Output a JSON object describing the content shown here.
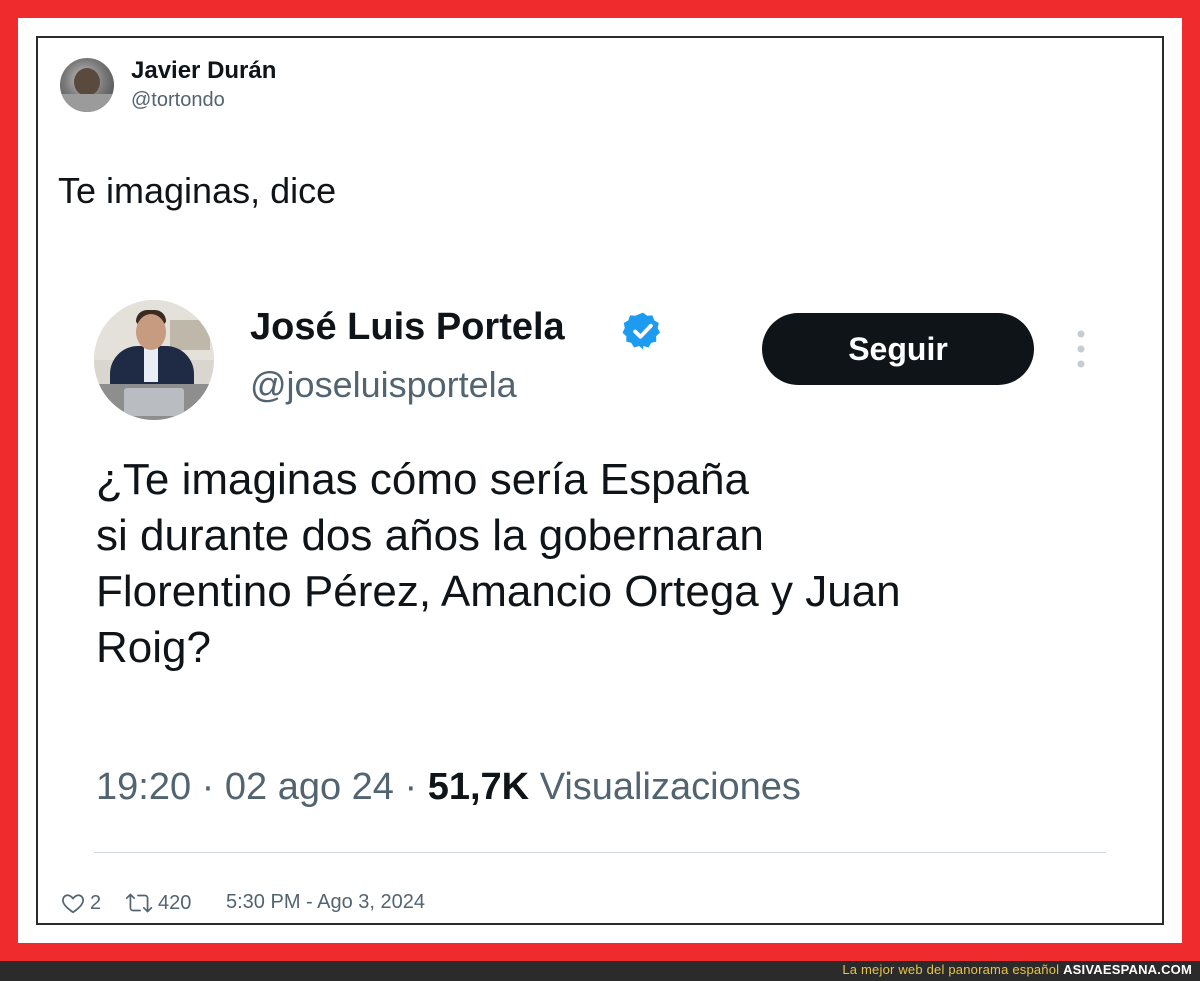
{
  "tweet": {
    "author_name": "Javier Durán",
    "author_handle": "@tortondo",
    "text": "Te imaginas, dice",
    "likes": "2",
    "retweets": "420",
    "timestamp": "5:30 PM - Ago 3, 2024"
  },
  "quoted_screenshot": {
    "author_name": "José Luis Portela",
    "author_handle": "@joseluisportela",
    "follow_label": "Seguir",
    "body_lines": [
      "¿Te imaginas cómo sería España",
      "si durante dos años la gobernaran",
      "Florentino Pérez, Amancio Ortega y Juan",
      "Roig?"
    ],
    "time": "19:20",
    "date": "02 ago 24",
    "views_count": "51,7K",
    "views_label": "Visualizaciones"
  },
  "footer": {
    "tagline": "La mejor web del panorama español",
    "site": "ASIVAESPANA.COM"
  },
  "colors": {
    "frame": "#ef2b2d",
    "text_primary": "#0f1419",
    "text_secondary": "#536471",
    "verified": "#1d9bf0",
    "button_bg": "#0f1419"
  },
  "icons": [
    "verified-badge-icon",
    "more-options-icon",
    "heart-icon",
    "retweet-icon"
  ]
}
